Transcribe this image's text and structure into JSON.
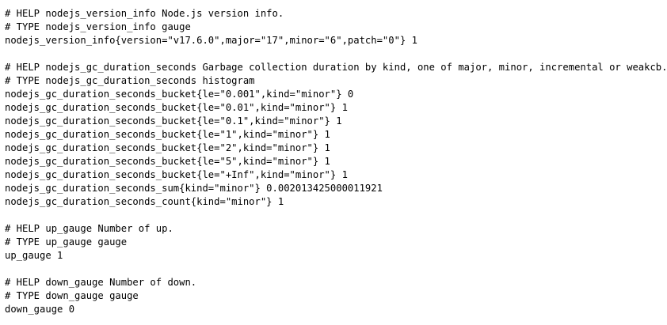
{
  "metrics_text": {
    "version_help": "# HELP nodejs_version_info Node.js version info.",
    "version_type": "# TYPE nodejs_version_info gauge",
    "version_value": "nodejs_version_info{version=\"v17.6.0\",major=\"17\",minor=\"6\",patch=\"0\"} 1",
    "gc_help": "# HELP nodejs_gc_duration_seconds Garbage collection duration by kind, one of major, minor, incremental or weakcb.",
    "gc_type": "# TYPE nodejs_gc_duration_seconds histogram",
    "gc_lines": [
      "nodejs_gc_duration_seconds_bucket{le=\"0.001\",kind=\"minor\"} 0",
      "nodejs_gc_duration_seconds_bucket{le=\"0.01\",kind=\"minor\"} 1",
      "nodejs_gc_duration_seconds_bucket{le=\"0.1\",kind=\"minor\"} 1",
      "nodejs_gc_duration_seconds_bucket{le=\"1\",kind=\"minor\"} 1",
      "nodejs_gc_duration_seconds_bucket{le=\"2\",kind=\"minor\"} 1",
      "nodejs_gc_duration_seconds_bucket{le=\"5\",kind=\"minor\"} 1",
      "nodejs_gc_duration_seconds_bucket{le=\"+Inf\",kind=\"minor\"} 1",
      "nodejs_gc_duration_seconds_sum{kind=\"minor\"} 0.002013425000011921",
      "nodejs_gc_duration_seconds_count{kind=\"minor\"} 1"
    ],
    "up_help": "# HELP up_gauge Number of up.",
    "up_type": "# TYPE up_gauge gauge",
    "up_value": "up_gauge 1",
    "down_help": "# HELP down_gauge Number of down.",
    "down_type": "# TYPE down_gauge gauge",
    "down_value": "down_gauge 0"
  }
}
